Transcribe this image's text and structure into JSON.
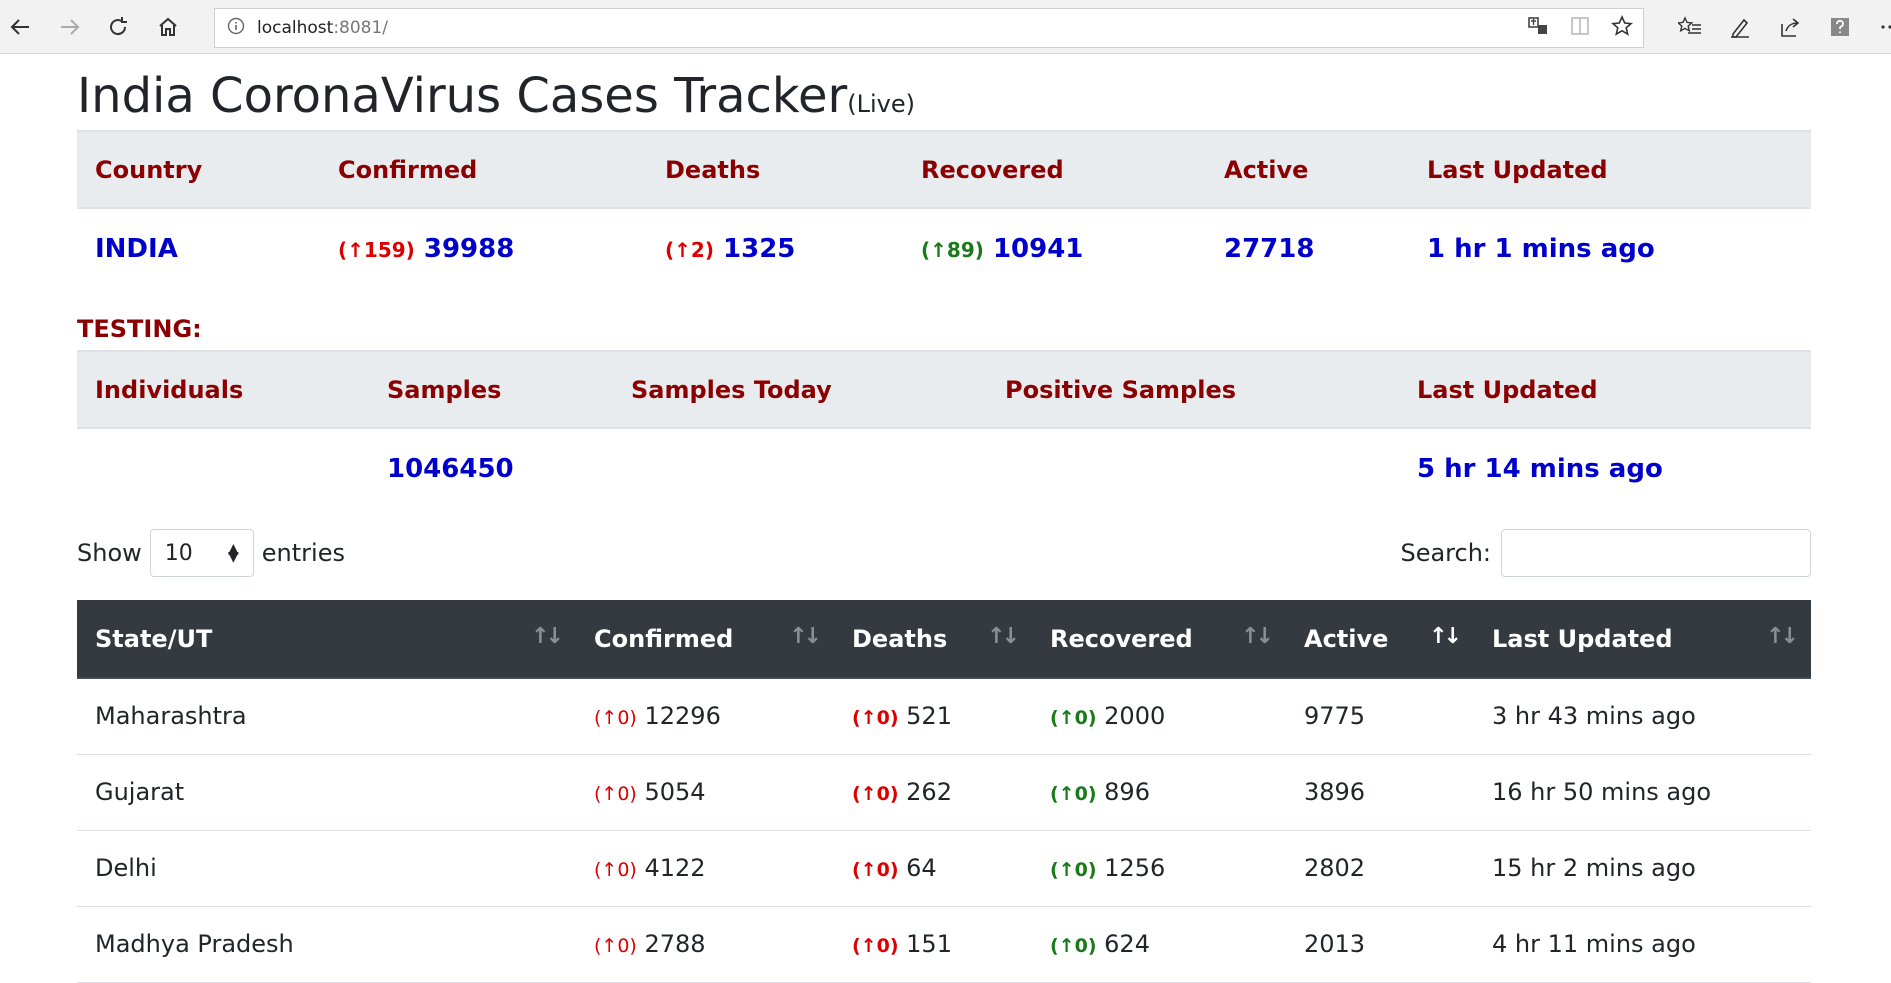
{
  "browser": {
    "url_host": "localhost",
    "url_port": ":8081/"
  },
  "header": {
    "title": "India CoronaVirus Cases Tracker",
    "badge": "(Live)"
  },
  "summary": {
    "headers": [
      "Country",
      "Confirmed",
      "Deaths",
      "Recovered",
      "Active",
      "Last Updated"
    ],
    "row": {
      "country": "INDIA",
      "confirmed_delta": "(↑159)",
      "confirmed": "39988",
      "deaths_delta": "(↑2)",
      "deaths": "1325",
      "recovered_delta": "(↑89)",
      "recovered": "10941",
      "active": "27718",
      "last_updated": "1 hr 1 mins ago"
    }
  },
  "testing": {
    "label": "TESTING:",
    "headers": [
      "Individuals",
      "Samples",
      "Samples Today",
      "Positive Samples",
      "Last Updated"
    ],
    "row": {
      "individuals": "",
      "samples": "1046450",
      "samples_today": "",
      "positive_samples": "",
      "last_updated": "5 hr 14 mins ago"
    }
  },
  "controls": {
    "show_label": "Show",
    "entries_value": "10",
    "entries_label": "entries",
    "search_label": "Search:",
    "search_value": ""
  },
  "states_table": {
    "headers": [
      "State/UT",
      "Confirmed",
      "Deaths",
      "Recovered",
      "Active",
      "Last Updated"
    ],
    "rows": [
      {
        "state": "Maharashtra",
        "confirmed_delta": "(↑0)",
        "confirmed": "12296",
        "deaths_delta": "(↑0)",
        "deaths": "521",
        "recovered_delta": "(↑0)",
        "recovered": "2000",
        "active": "9775",
        "last_updated": "3 hr 43 mins ago"
      },
      {
        "state": "Gujarat",
        "confirmed_delta": "(↑0)",
        "confirmed": "5054",
        "deaths_delta": "(↑0)",
        "deaths": "262",
        "recovered_delta": "(↑0)",
        "recovered": "896",
        "active": "3896",
        "last_updated": "16 hr 50 mins ago"
      },
      {
        "state": "Delhi",
        "confirmed_delta": "(↑0)",
        "confirmed": "4122",
        "deaths_delta": "(↑0)",
        "deaths": "64",
        "recovered_delta": "(↑0)",
        "recovered": "1256",
        "active": "2802",
        "last_updated": "15 hr 2 mins ago"
      },
      {
        "state": "Madhya Pradesh",
        "confirmed_delta": "(↑0)",
        "confirmed": "2788",
        "deaths_delta": "(↑0)",
        "deaths": "151",
        "recovered_delta": "(↑0)",
        "recovered": "624",
        "active": "2013",
        "last_updated": "4 hr 11 mins ago"
      }
    ]
  },
  "colors": {
    "header_text": "#8b0000",
    "value_blue": "#0000cc",
    "delta_red": "#dc0000",
    "delta_green": "#1a7a1a",
    "table_head_bg": "#343a40"
  }
}
